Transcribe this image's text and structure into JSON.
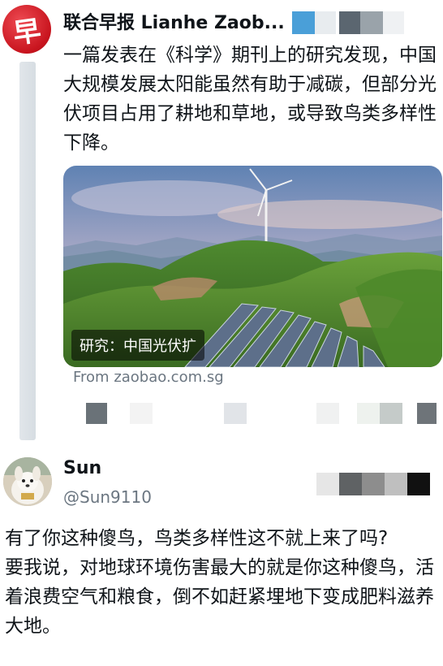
{
  "tweet": {
    "author": "联合早报 Lianhe Zaob...",
    "avatar_glyph": "早",
    "text": "一篇发表在《科学》期刊上的研究发现，中国大规模发展太阳能虽然有助于减碳，但部分光伏项目占用了耕地和草地，或导致鸟类多样性下降。",
    "card": {
      "caption": "研究：中国光伏扩",
      "source": "From zaobao.com.sg"
    }
  },
  "reply": {
    "author": "Sun",
    "handle": "@Sun9110",
    "lines": [
      "有了你这种傻鸟，鸟类多样性这不就上来了吗?",
      "要我说，对地球环境伤害最大的就是你这种傻鸟，活着浪费空气和粮食，倒不如赶紧埋地下变成肥料滋养大地。"
    ]
  },
  "colors": {
    "brand_red": "#c8141e",
    "muted_text": "#6b7681",
    "thread_line": "#cfd8de"
  },
  "icons": [
    "zaobao-logo-icon",
    "user-avatar-icon"
  ]
}
